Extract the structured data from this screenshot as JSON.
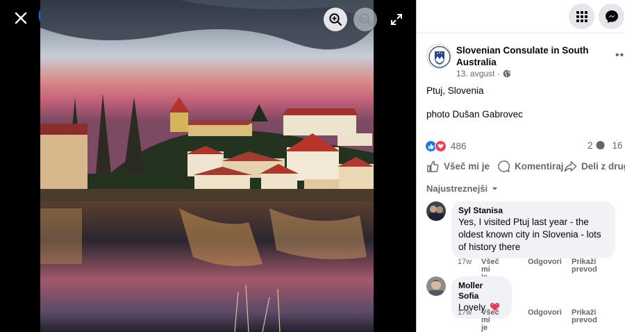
{
  "viewer": {
    "close_icon": "close-icon",
    "logo_icon": "facebook-logo-icon",
    "zoom_in_icon": "zoom-in-icon",
    "zoom_out_icon": "zoom-out-icon",
    "fullscreen_icon": "fullscreen-icon"
  },
  "topbar": {
    "menu_icon": "grid-menu-icon",
    "messenger_icon": "messenger-icon"
  },
  "post": {
    "page_name": "Slovenian Consulate in South Australia",
    "date": "13. avgust",
    "date_separator": "·",
    "audience_icon": "globe-icon",
    "text_line1": "Ptuj, Slovenia",
    "text_line2": "photo Dušan Gabrovec",
    "reaction_count": "486",
    "comment_count": "2",
    "share_count": "16",
    "actions": {
      "like": "Všeč mi je",
      "comment": "Komentiraj",
      "share": "Deli z drug"
    },
    "sort_label": "Najustreznejši"
  },
  "comments": [
    {
      "author": "Syl Stanisa",
      "text_lines": [
        "Yes, I visited Ptuj last year - the",
        "oldest known city in Slovenia - lots",
        "of history there"
      ],
      "time": "17w",
      "like": "Všeč mi\nje",
      "reply": "Odgovori",
      "translate": "Prikaži\nprevod"
    },
    {
      "author": "Moller Sofia",
      "text": "Lovely",
      "time": "17w",
      "like": "Všeč mi\nje",
      "reply": "Odgovori",
      "translate": "Prikaži\nprevod"
    }
  ],
  "colors": {
    "facebook_blue": "#0866ff",
    "like_blue": "#1877f2",
    "love_red": "#f33e58",
    "text_secondary": "#65676b"
  }
}
